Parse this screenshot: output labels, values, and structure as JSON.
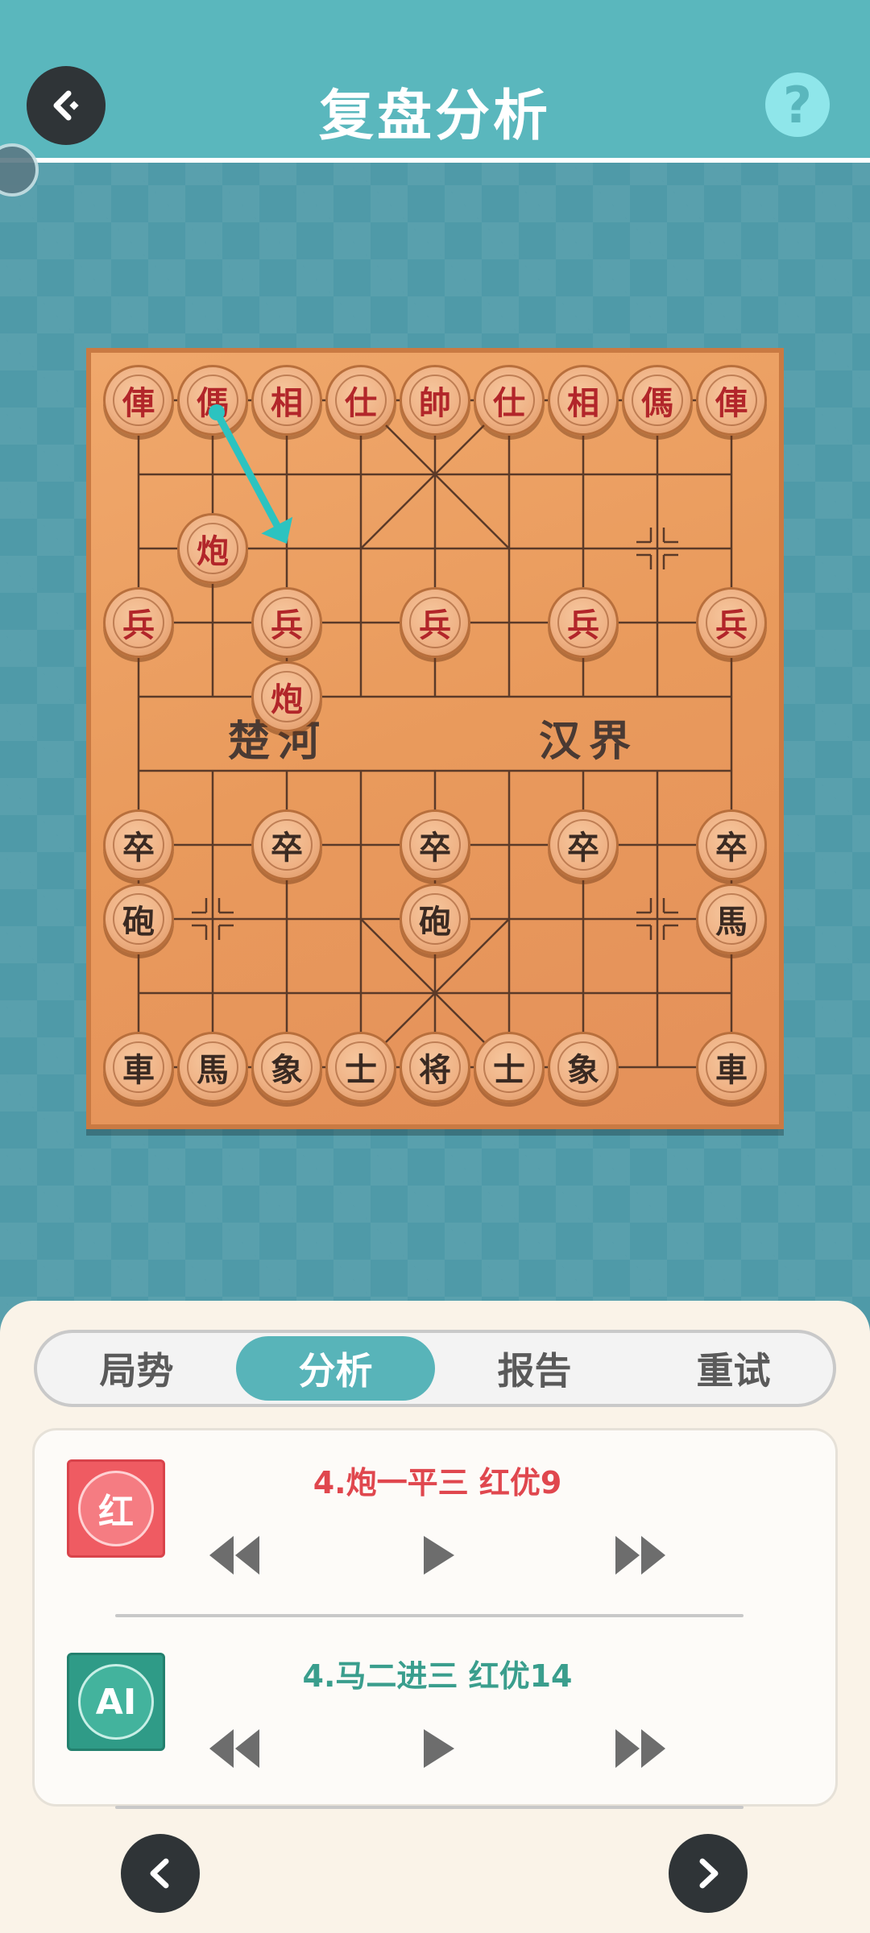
{
  "header": {
    "title": "复盘分析",
    "help_label": "?"
  },
  "board": {
    "river_left": "楚河",
    "river_right": "汉界",
    "pieces": [
      {
        "side": "red",
        "text": "俥",
        "col": 0,
        "row": 0
      },
      {
        "side": "red",
        "text": "傌",
        "col": 1,
        "row": 0
      },
      {
        "side": "red",
        "text": "相",
        "col": 2,
        "row": 0
      },
      {
        "side": "red",
        "text": "仕",
        "col": 3,
        "row": 0
      },
      {
        "side": "red",
        "text": "帥",
        "col": 4,
        "row": 0
      },
      {
        "side": "red",
        "text": "仕",
        "col": 5,
        "row": 0
      },
      {
        "side": "red",
        "text": "相",
        "col": 6,
        "row": 0
      },
      {
        "side": "red",
        "text": "傌",
        "col": 7,
        "row": 0
      },
      {
        "side": "red",
        "text": "俥",
        "col": 8,
        "row": 0
      },
      {
        "side": "red",
        "text": "炮",
        "col": 1,
        "row": 2
      },
      {
        "side": "red",
        "text": "兵",
        "col": 0,
        "row": 3
      },
      {
        "side": "red",
        "text": "兵",
        "col": 2,
        "row": 3
      },
      {
        "side": "red",
        "text": "兵",
        "col": 4,
        "row": 3
      },
      {
        "side": "red",
        "text": "兵",
        "col": 6,
        "row": 3
      },
      {
        "side": "red",
        "text": "兵",
        "col": 8,
        "row": 3
      },
      {
        "side": "red",
        "text": "炮",
        "col": 2,
        "row": 4
      },
      {
        "side": "black",
        "text": "卒",
        "col": 0,
        "row": 6
      },
      {
        "side": "black",
        "text": "卒",
        "col": 2,
        "row": 6
      },
      {
        "side": "black",
        "text": "卒",
        "col": 4,
        "row": 6
      },
      {
        "side": "black",
        "text": "卒",
        "col": 6,
        "row": 6
      },
      {
        "side": "black",
        "text": "卒",
        "col": 8,
        "row": 6
      },
      {
        "side": "black",
        "text": "砲",
        "col": 0,
        "row": 7
      },
      {
        "side": "black",
        "text": "砲",
        "col": 4,
        "row": 7
      },
      {
        "side": "black",
        "text": "馬",
        "col": 8,
        "row": 7
      },
      {
        "side": "black",
        "text": "車",
        "col": 0,
        "row": 9
      },
      {
        "side": "black",
        "text": "馬",
        "col": 1,
        "row": 9
      },
      {
        "side": "black",
        "text": "象",
        "col": 2,
        "row": 9
      },
      {
        "side": "black",
        "text": "士",
        "col": 3,
        "row": 9
      },
      {
        "side": "black",
        "text": "将",
        "col": 4,
        "row": 9
      },
      {
        "side": "black",
        "text": "士",
        "col": 5,
        "row": 9
      },
      {
        "side": "black",
        "text": "象",
        "col": 6,
        "row": 9
      },
      {
        "side": "black",
        "text": "車",
        "col": 8,
        "row": 9
      }
    ],
    "hint_arrow": {
      "from": {
        "col": 1,
        "row": 0
      },
      "to": {
        "col": 2,
        "row": 2
      },
      "color": "#2cc3c0"
    }
  },
  "panel": {
    "tabs": [
      {
        "label": "局势",
        "active": false
      },
      {
        "label": "分析",
        "active": true
      },
      {
        "label": "报告",
        "active": false
      },
      {
        "label": "重试",
        "active": false
      }
    ],
    "red_row": {
      "badge": "红",
      "move": "4.炮一平三 红优9",
      "color": "#e0474e"
    },
    "ai_row": {
      "badge": "AI",
      "move": "4.马二进三 红优14",
      "color": "#3a9e8d"
    }
  }
}
